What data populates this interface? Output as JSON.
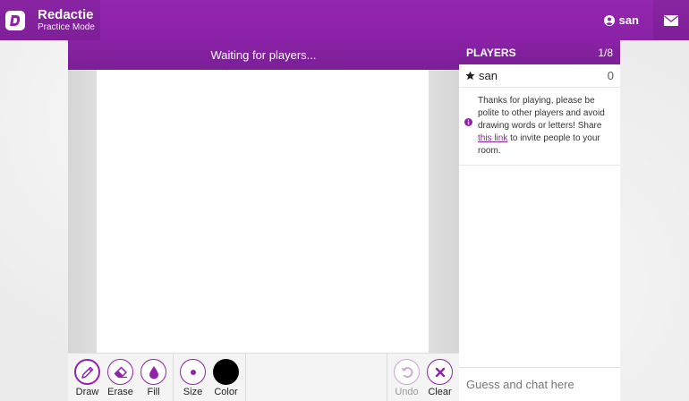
{
  "app": {
    "title": "Redactie",
    "subtitle": "Practice Mode"
  },
  "header": {
    "user_name": "san",
    "icons": {
      "user": "user-circle-icon",
      "mail": "envelope-icon"
    }
  },
  "status": {
    "text": "Waiting for players..."
  },
  "tools": {
    "draw": "Draw",
    "erase": "Erase",
    "fill": "Fill",
    "size": "Size",
    "color": "Color",
    "undo": "Undo",
    "clear": "Clear",
    "selected_color": "#000000",
    "accent": "#8e24aa"
  },
  "players": {
    "header": "PLAYERS",
    "count": "1/8",
    "list": [
      {
        "name": "san",
        "score": "0"
      }
    ]
  },
  "info": {
    "text_before": "Thanks for playing, please be polite to other players and avoid drawing words or letters! Share ",
    "link_text": "this link",
    "text_after": " to invite people to your room."
  },
  "chat": {
    "placeholder": "Guess and chat here"
  }
}
